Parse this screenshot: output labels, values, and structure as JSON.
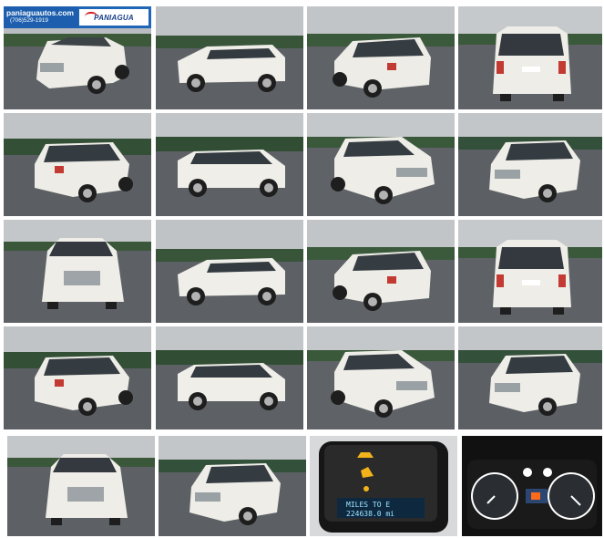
{
  "gallery": {
    "dealer": {
      "website": "paniaguautos.com",
      "phone": "(706)529-1919",
      "brand": "PANIAGUA"
    },
    "photos": [
      {
        "view": "front-left"
      },
      {
        "view": "side"
      },
      {
        "view": "rear-left"
      },
      {
        "view": "rear"
      },
      {
        "view": "rear-left"
      },
      {
        "view": "side-right"
      },
      {
        "view": "front-left"
      },
      {
        "view": "front-right"
      },
      {
        "view": "front"
      },
      {
        "view": "side"
      },
      {
        "view": "rear-left"
      },
      {
        "view": "rear"
      },
      {
        "view": "rear-left"
      },
      {
        "view": "side-right"
      },
      {
        "view": "front-left"
      },
      {
        "view": "front-right"
      },
      {
        "view": "front"
      },
      {
        "view": "front-left"
      },
      {
        "view": "dash-display"
      },
      {
        "view": "instrument-cluster"
      }
    ],
    "dash_display": {
      "line1": "MILES TO E",
      "line2": "224638.0 mi"
    }
  }
}
